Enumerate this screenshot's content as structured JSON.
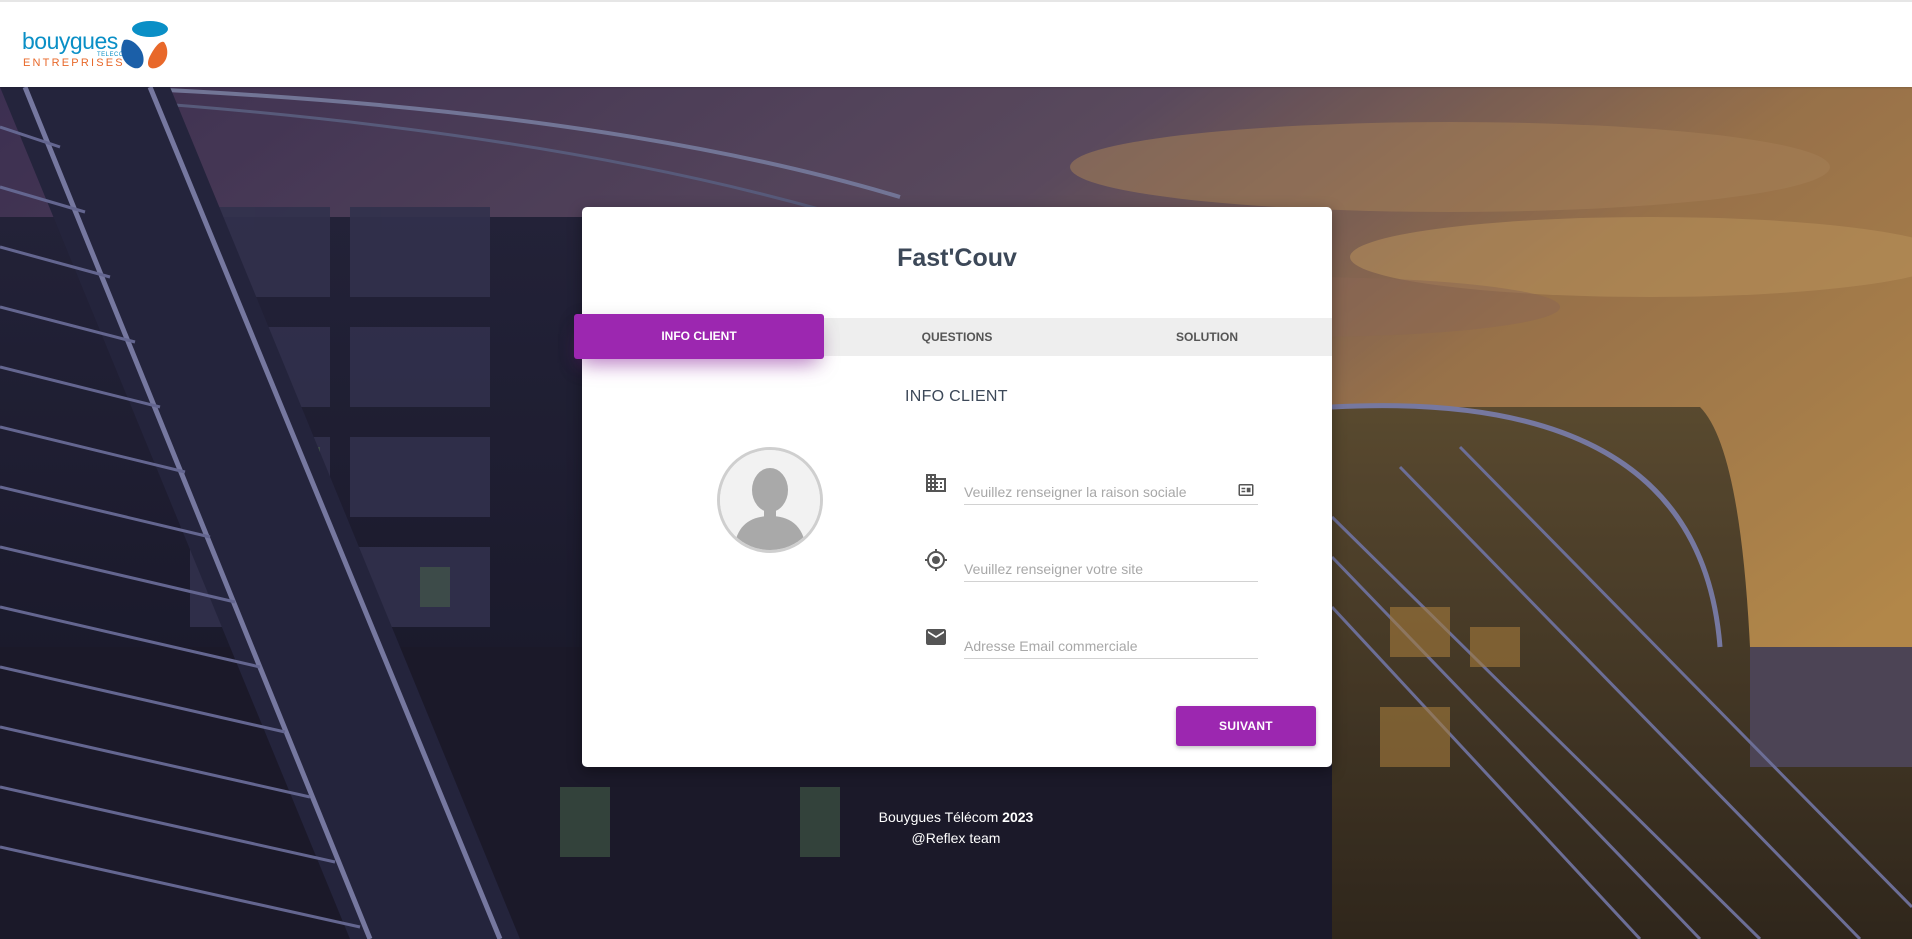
{
  "header": {
    "logo_word": "bouygues",
    "logo_telecom": "TELECOM",
    "logo_sub": "ENTREPRISES",
    "logo_icon": "bouygues-telecom-logo",
    "colors": {
      "blue": "#0a8fc6",
      "dark_blue": "#1b5fa8",
      "orange": "#e8682a"
    }
  },
  "card": {
    "title": "Fast'Couv",
    "tabs": [
      {
        "label": "INFO CLIENT",
        "active": true
      },
      {
        "label": "QUESTIONS",
        "active": false
      },
      {
        "label": "SOLUTION",
        "active": false
      }
    ],
    "section_title": "INFO CLIENT",
    "avatar_icon": "user-avatar-icon",
    "fields": [
      {
        "icon": "business-icon",
        "placeholder": "Veuillez renseigner la raison sociale",
        "value": "",
        "trailing_icon": "contact-card-icon"
      },
      {
        "icon": "location-target-icon",
        "placeholder": "Veuillez renseigner votre site",
        "value": ""
      },
      {
        "icon": "mail-icon",
        "placeholder": "Adresse Email commerciale",
        "value": ""
      }
    ],
    "next_button": "SUIVANT",
    "accent_color": "#9c27b0"
  },
  "footer": {
    "company": "Bouygues Télécom",
    "year": "2023",
    "team": "@Reflex team"
  }
}
